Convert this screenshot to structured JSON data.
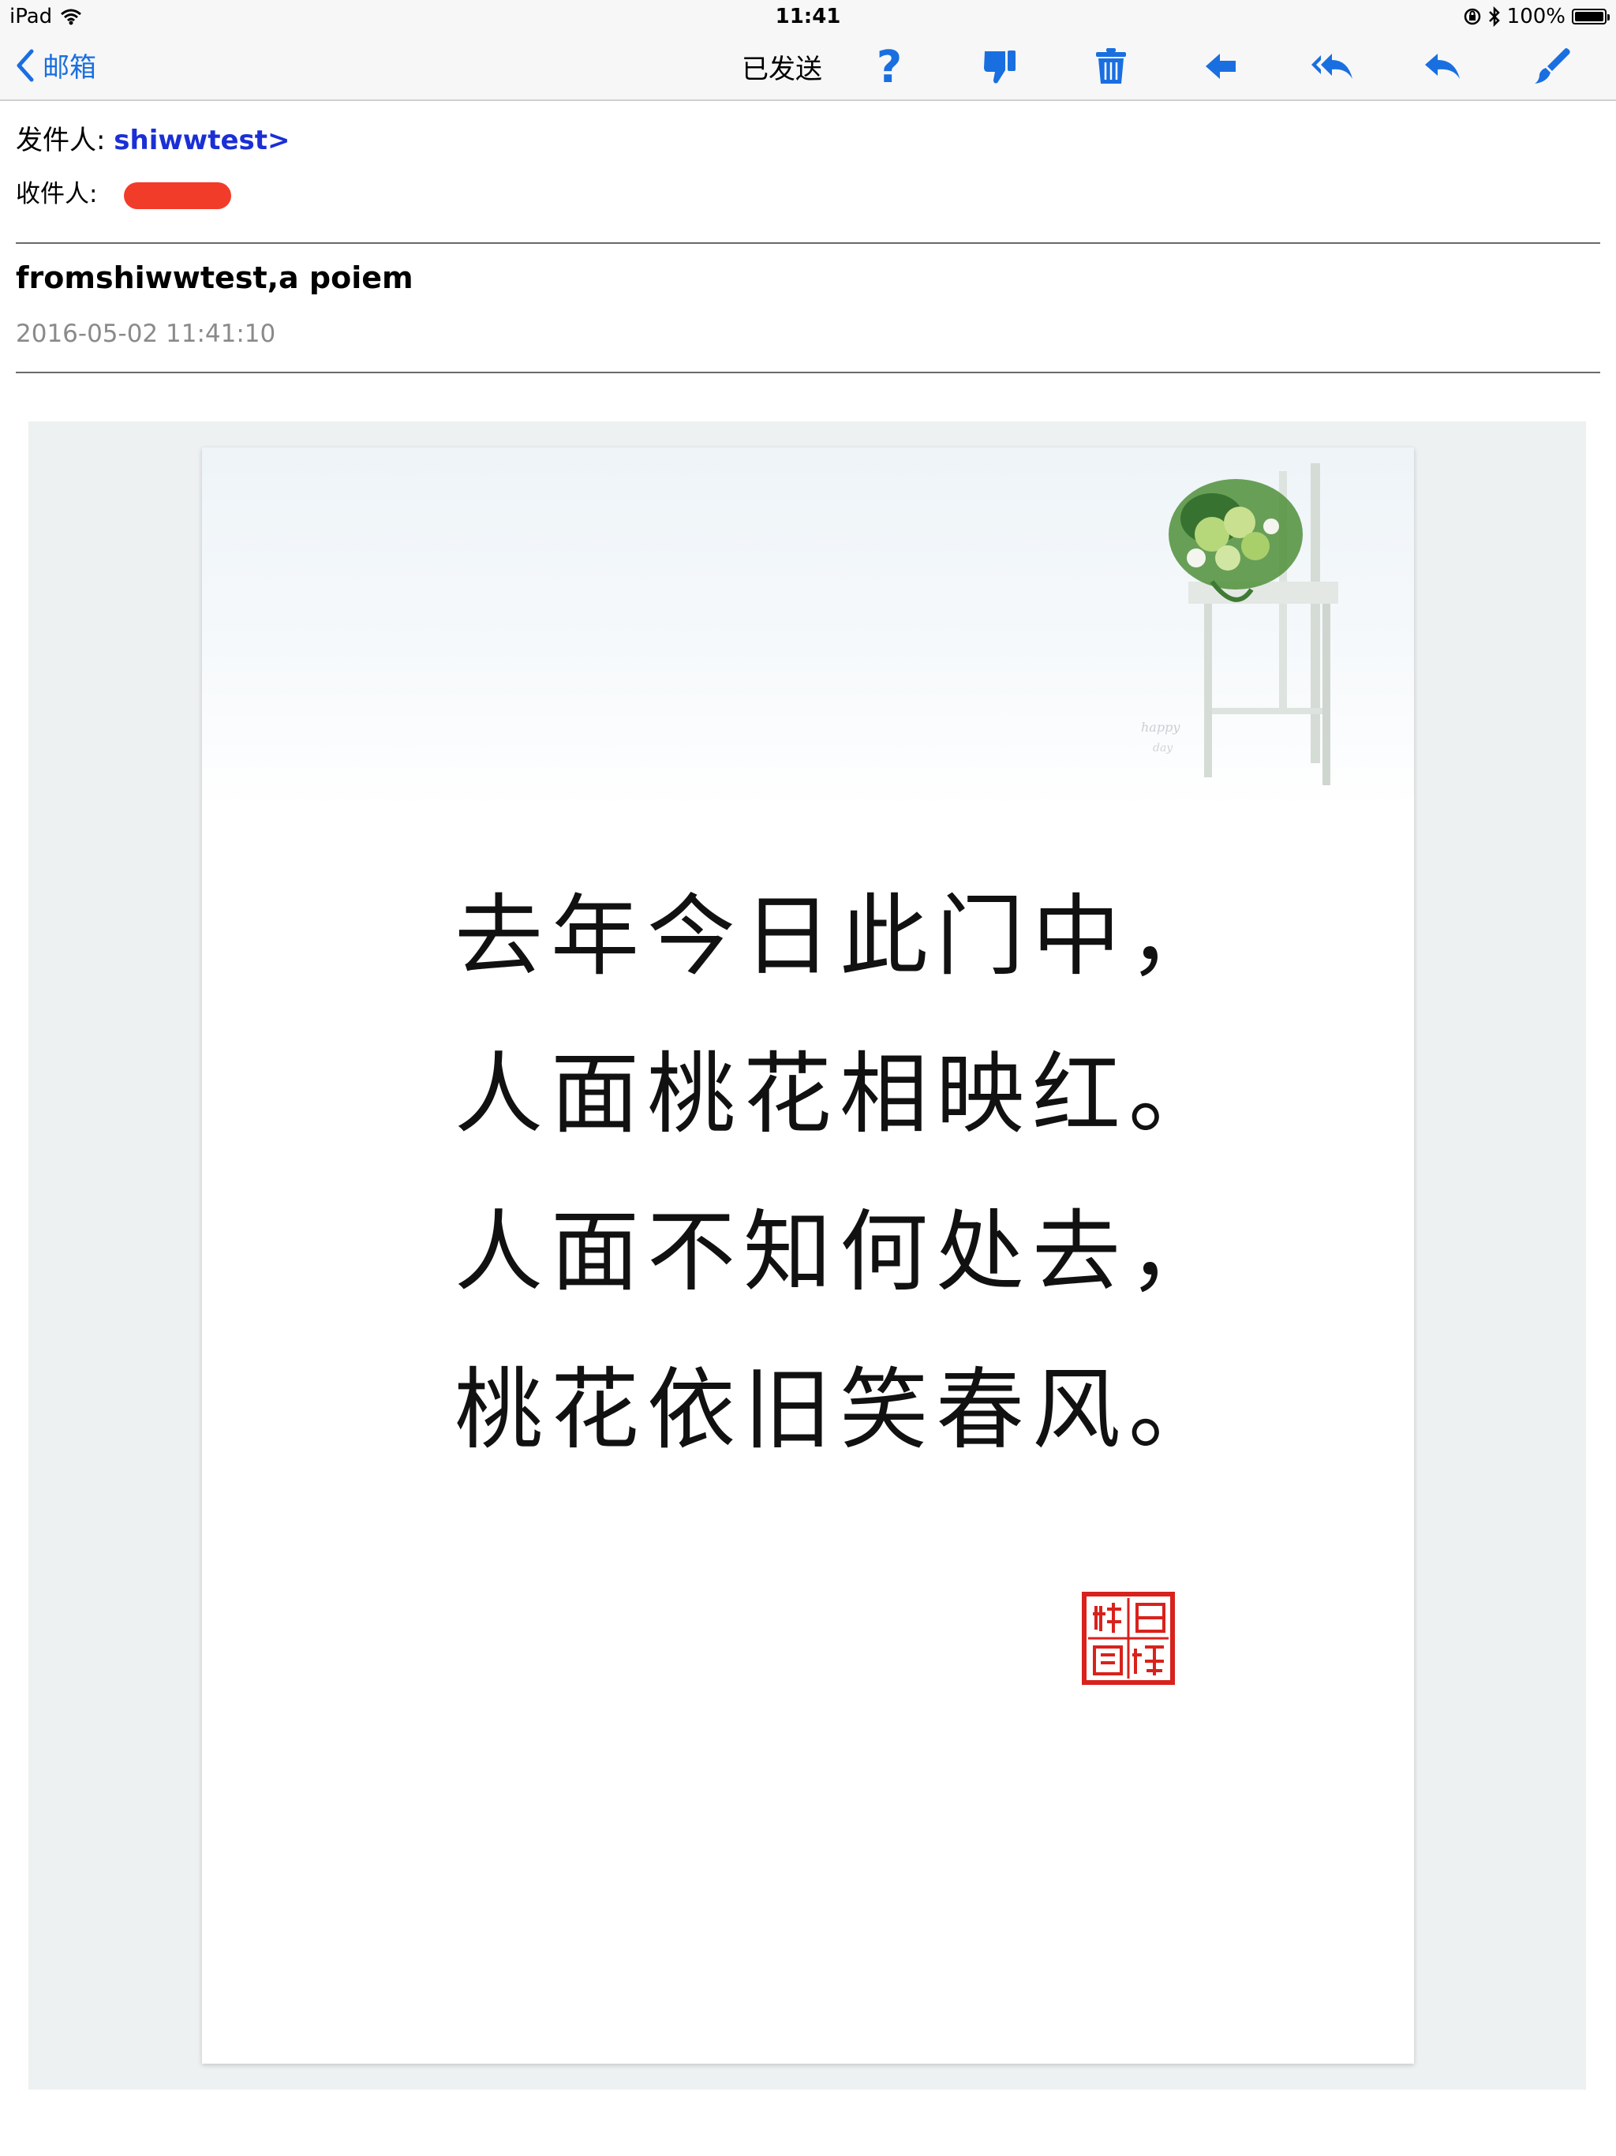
{
  "status_bar": {
    "device": "iPad",
    "time": "11:41",
    "battery": "100%",
    "battery_level": 1.0
  },
  "nav": {
    "back_label": "邮箱",
    "title": "已发送",
    "toolbar_icons": [
      "help-icon",
      "thumbs-down-icon",
      "trash-icon",
      "forward-icon",
      "reply-all-icon",
      "reply-icon",
      "compose-icon"
    ]
  },
  "email": {
    "from_label": "发件人:",
    "from_value": "shiwwtest>",
    "to_label": "收件人:",
    "subject": "fromshiwwtest,a poiem",
    "date": "2016-05-02 11:41:10"
  },
  "colors": {
    "accent": "#1a6fe0",
    "sender": "#1b2fd6",
    "redact": "#f23c2a",
    "seal": "#d8221c",
    "canvas": "#eef1f2"
  },
  "letter": {
    "poem": "去年今日此门中，\n人面桃花相映红。\n人面不知何处去，\n桃花依旧笑春风。"
  }
}
